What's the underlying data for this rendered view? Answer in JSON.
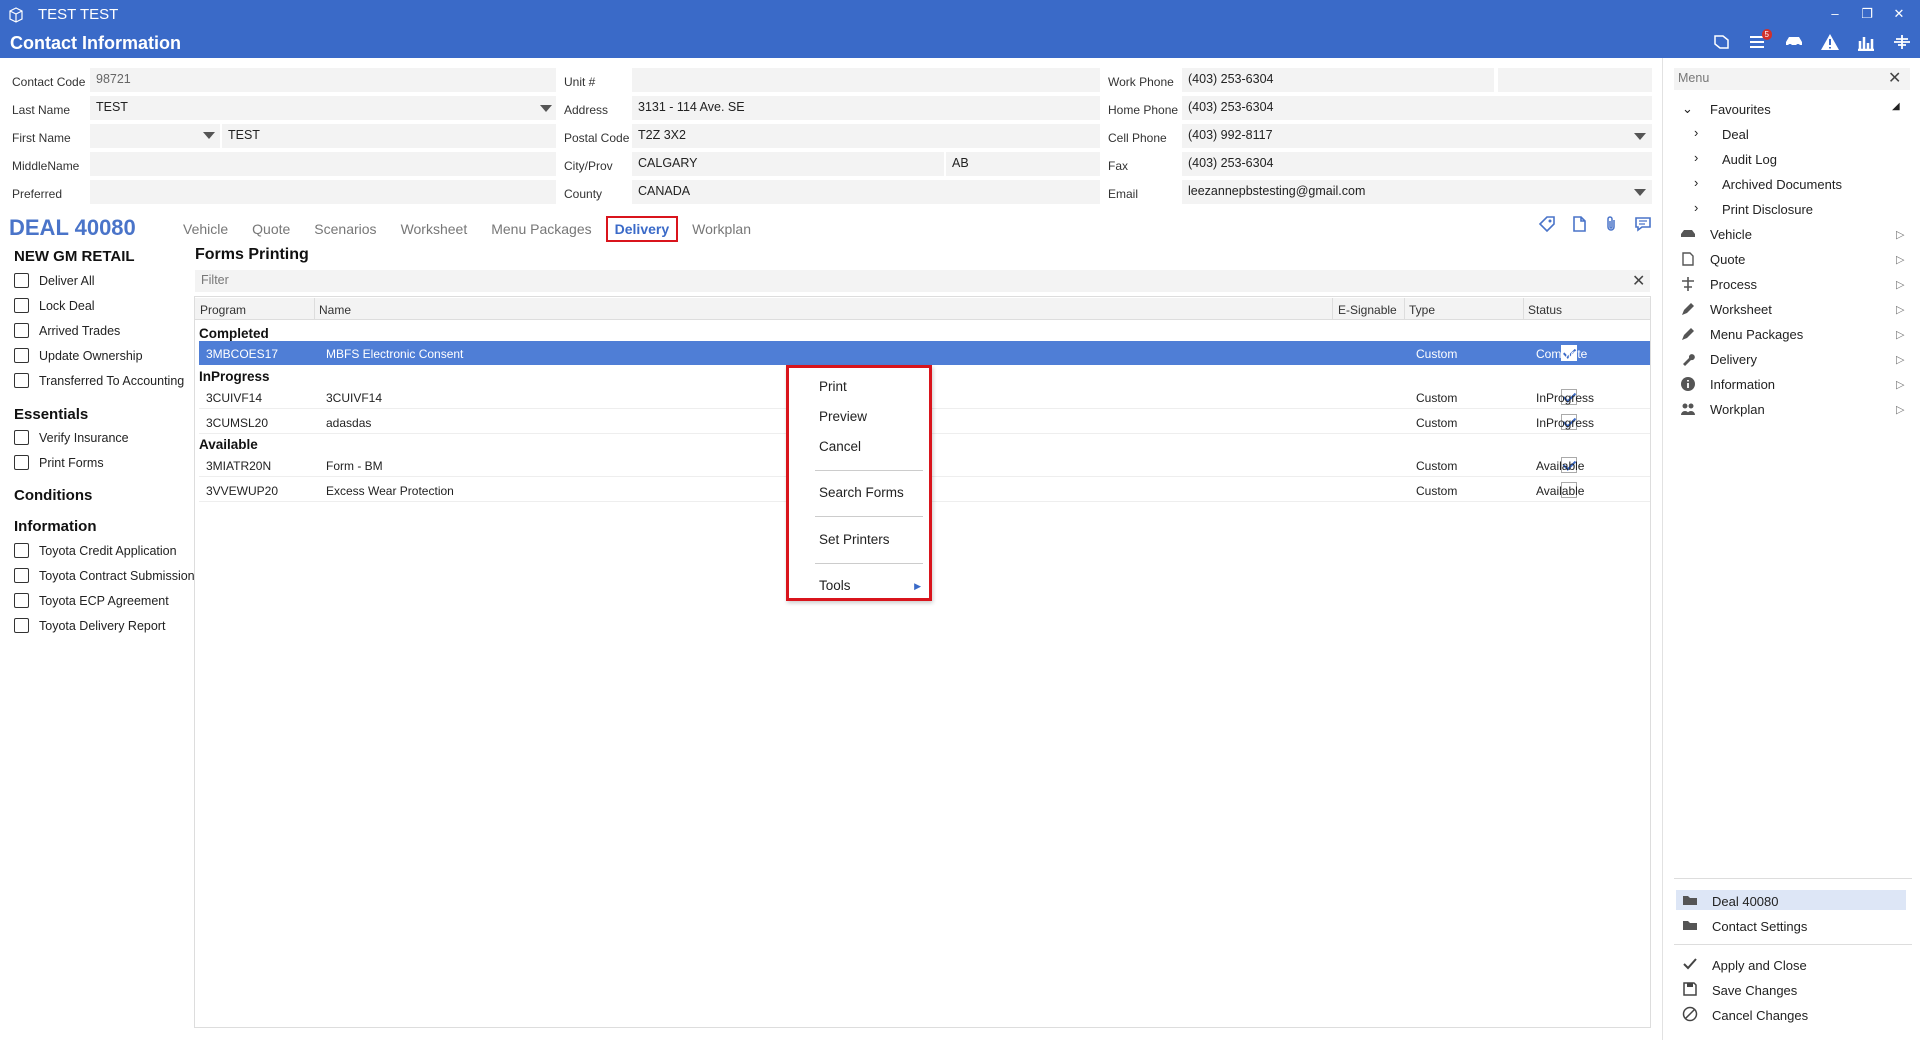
{
  "window": {
    "app_title": "TEST TEST",
    "page_title": "Contact Information",
    "notification_count": "5"
  },
  "contact": {
    "contact_code_label": "Contact Code",
    "contact_code": "98721",
    "last_name_label": "Last Name",
    "last_name": "TEST",
    "first_name_label": "First Name",
    "first_name": "TEST",
    "middle_name_label": "MiddleName",
    "middle_name": "",
    "preferred_label": "Preferred",
    "preferred": "",
    "unit_label": "Unit #",
    "unit": "",
    "address_label": "Address",
    "address": "3131 - 114 Ave. SE",
    "postal_label": "Postal Code",
    "postal": "T2Z 3X2",
    "city_label": "City/Prov",
    "city": "CALGARY",
    "prov": "AB",
    "county_label": "County",
    "county": "CANADA",
    "work_phone_label": "Work Phone",
    "work_phone": "(403) 253-6304",
    "home_phone_label": "Home Phone",
    "home_phone": "(403) 253-6304",
    "cell_phone_label": "Cell Phone",
    "cell_phone": "(403) 992-8117",
    "fax_label": "Fax",
    "fax": "(403) 253-6304",
    "email_label": "Email",
    "email": "leezannepbstesting@gmail.com"
  },
  "deal": {
    "title": "DEAL 40080",
    "tabs": [
      "Vehicle",
      "Quote",
      "Scenarios",
      "Worksheet",
      "Menu Packages",
      "Delivery",
      "Workplan"
    ],
    "active_tab": "Delivery"
  },
  "checklist": {
    "sections": [
      {
        "title": "NEW GM RETAIL",
        "items": [
          "Deliver All",
          "Lock Deal",
          "Arrived Trades",
          "Update Ownership",
          "Transferred To Accounting"
        ]
      },
      {
        "title": "Essentials",
        "items": [
          "Verify Insurance",
          "Print Forms"
        ]
      },
      {
        "title": "Conditions",
        "items": []
      },
      {
        "title": "Information",
        "items": [
          "Toyota Credit Application",
          "Toyota Contract Submission",
          "Toyota ECP Agreement",
          "Toyota Delivery Report"
        ]
      }
    ]
  },
  "forms": {
    "title": "Forms Printing",
    "filter_placeholder": "Filter",
    "columns": {
      "program": "Program",
      "name": "Name",
      "esignable": "E-Signable",
      "type": "Type",
      "status": "Status"
    },
    "groups": [
      {
        "label": "Completed",
        "rows": [
          {
            "program": "3MBCOES17",
            "name": "MBFS Electronic Consent",
            "esignable": true,
            "type": "Custom",
            "status": "Complete",
            "selected": true
          }
        ]
      },
      {
        "label": "InProgress",
        "rows": [
          {
            "program": "3CUIVF14",
            "name": "3CUIVF14",
            "esignable": true,
            "type": "Custom",
            "status": "InProgress",
            "selected": false
          },
          {
            "program": "3CUMSL20",
            "name": "adasdas",
            "esignable": true,
            "type": "Custom",
            "status": "InProgress",
            "selected": false
          }
        ]
      },
      {
        "label": "Available",
        "rows": [
          {
            "program": "3MIATR20N",
            "name": "Form - BM",
            "esignable": true,
            "type": "Custom",
            "status": "Available",
            "selected": false
          },
          {
            "program": "3VVEWUP20",
            "name": "Excess Wear Protection",
            "esignable": false,
            "type": "Custom",
            "status": "Available",
            "selected": false
          }
        ]
      }
    ]
  },
  "context_menu": {
    "print": "Print",
    "preview": "Preview",
    "cancel": "Cancel",
    "search_forms": "Search Forms",
    "set_printers": "Set Printers",
    "tools": "Tools"
  },
  "side_menu": {
    "header": "Menu",
    "favourites": "Favourites",
    "favourite_items": [
      "Deal",
      "Audit Log",
      "Archived Documents",
      "Print Disclosure"
    ],
    "items": [
      "Vehicle",
      "Quote",
      "Process",
      "Worksheet",
      "Menu Packages",
      "Delivery",
      "Information",
      "Workplan"
    ],
    "bottom": {
      "deal": "Deal 40080",
      "contact_settings": "Contact Settings",
      "apply_close": "Apply and Close",
      "save_changes": "Save Changes",
      "cancel_changes": "Cancel Changes"
    }
  },
  "colors": {
    "accent": "#3a6ac8",
    "selection": "#4f7ed6",
    "highlight_border": "#d9141c"
  }
}
